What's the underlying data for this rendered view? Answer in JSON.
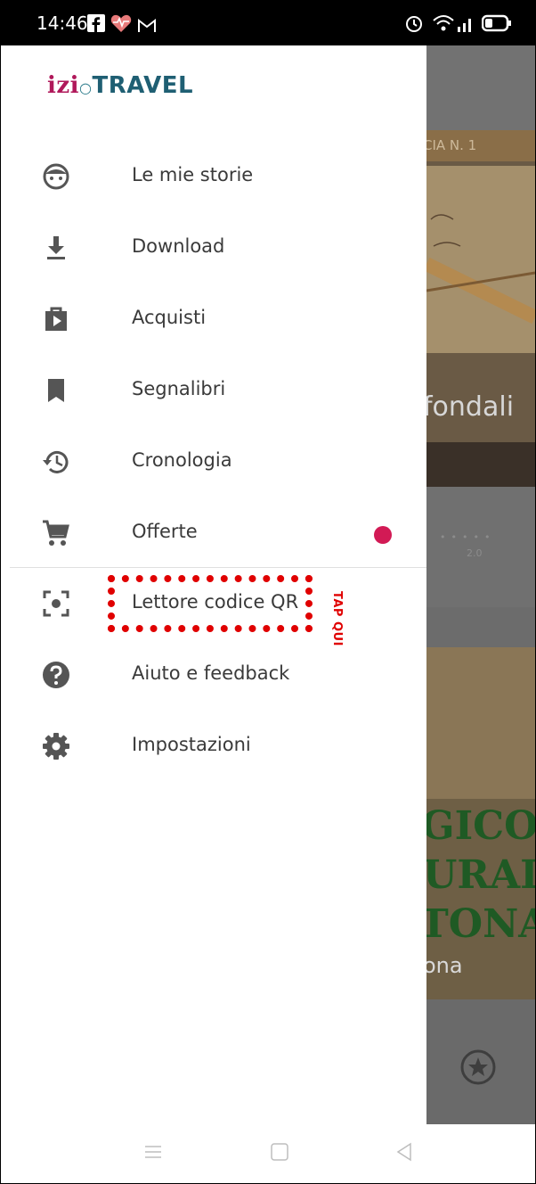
{
  "status_bar": {
    "time": "14:46",
    "left_icons": [
      "facebook-icon",
      "health-heart-icon",
      "gmail-icon"
    ],
    "right_icons": [
      "alarm-icon",
      "wifi-icon",
      "signal-icon",
      "battery-icon"
    ]
  },
  "drawer": {
    "logo_izi": "izi",
    "logo_travel": "TRAVEL",
    "items": [
      {
        "label": "Le mie storie",
        "icon": "face-icon"
      },
      {
        "label": "Download",
        "icon": "download-icon"
      },
      {
        "label": "Acquisti",
        "icon": "shop-bag-icon"
      },
      {
        "label": "Segnalibri",
        "icon": "bookmark-icon"
      },
      {
        "label": "Cronologia",
        "icon": "history-icon"
      },
      {
        "label": "Offerte",
        "icon": "cart-icon",
        "badge": true
      },
      {
        "label": "Lettore codice QR",
        "icon": "qr-scanner-icon"
      },
      {
        "label": "Aiuto e feedback",
        "icon": "help-icon"
      },
      {
        "label": "Impostazioni",
        "icon": "settings-gear-icon"
      }
    ],
    "badge_color": "#d21a55"
  },
  "annotation": {
    "text": "TAP QUI",
    "color": "#e00000"
  },
  "background_app": {
    "banner_text": "CIA N. 1",
    "title_fragment": "fondali",
    "rating_text": "2.0",
    "poster_line1": "GICO",
    "poster_line2": "URALE",
    "poster_line3": "TONA",
    "subtitle_fragment": "ona"
  },
  "nav_bar": {
    "icons": [
      "menu-nav-icon",
      "home-nav-icon",
      "back-nav-icon"
    ]
  }
}
